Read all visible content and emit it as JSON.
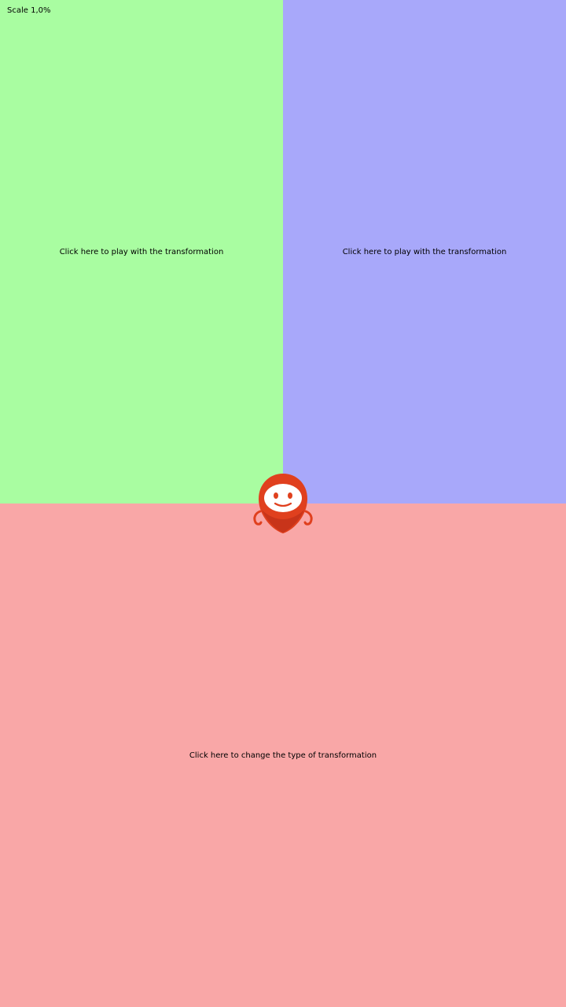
{
  "status": {
    "scale_text": "Scale 1,0%"
  },
  "zones": {
    "left": {
      "label": "Click here to play with the transformation",
      "color": "#a9fda1"
    },
    "right": {
      "label": "Click here to play with the transformation",
      "color": "#a8a8fa"
    },
    "bottom": {
      "label": "Click here to change the type of transformation",
      "color": "#f9a7a7"
    }
  },
  "mascot": {
    "icon": "robot-mascot-icon",
    "body_color": "#e0401e",
    "face_color": "#ffffff"
  }
}
